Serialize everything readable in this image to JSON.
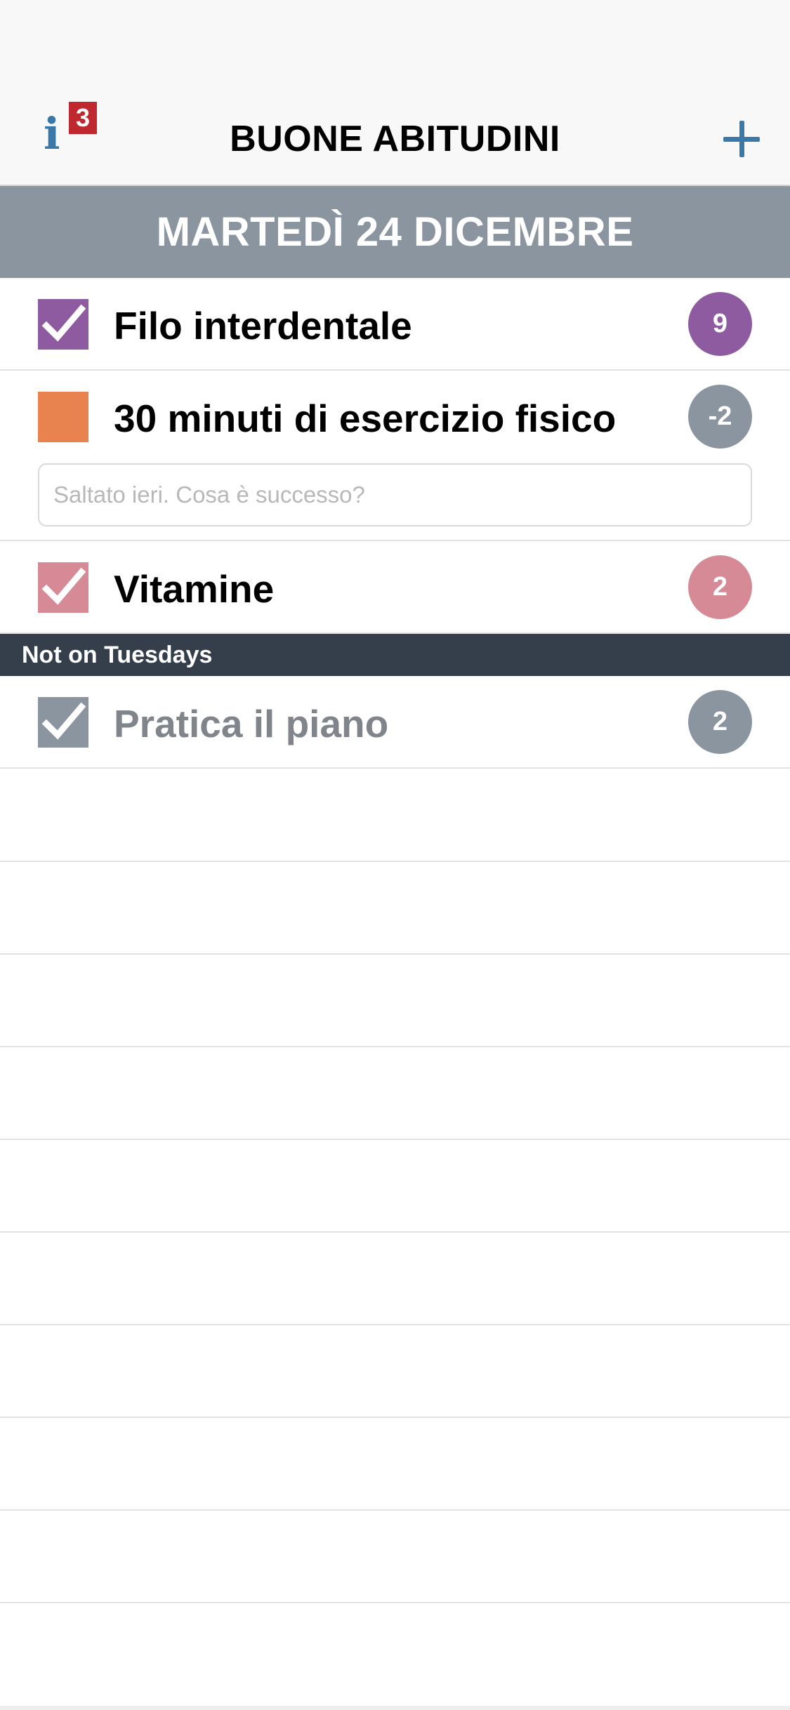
{
  "navbar": {
    "info_icon": "info-icon",
    "info_badge": "3",
    "title": "BUONE ABITUDINI",
    "add_icon": "plus-icon"
  },
  "date_header": "MARTEDÌ 24 DICEMBRE",
  "habits": [
    {
      "label": "Filo interdentale",
      "checked": true,
      "color": "#8e5ba0",
      "streak": "9",
      "streak_color": "#8e5ba0"
    },
    {
      "label": "30 minuti di esercizio fisico",
      "checked": false,
      "color": "#e8834f",
      "streak": "-2",
      "streak_color": "#8a959f",
      "note_placeholder": "Saltato ieri. Cosa è successo?"
    },
    {
      "label": "Vitamine",
      "checked": true,
      "color": "#d58a95",
      "streak": "2",
      "streak_color": "#d58a95"
    }
  ],
  "section": {
    "title": "Not on Tuesdays",
    "habits": [
      {
        "label": "Pratica il piano",
        "checked": true,
        "color": "#8a959f",
        "streak": "2",
        "streak_color": "#8a959f"
      }
    ]
  },
  "colors": {
    "accent": "#3a78a8",
    "badge": "#c0282f",
    "date_bar": "#8a959f",
    "section_bar": "#353f4b",
    "muted_text": "#7f858b"
  }
}
